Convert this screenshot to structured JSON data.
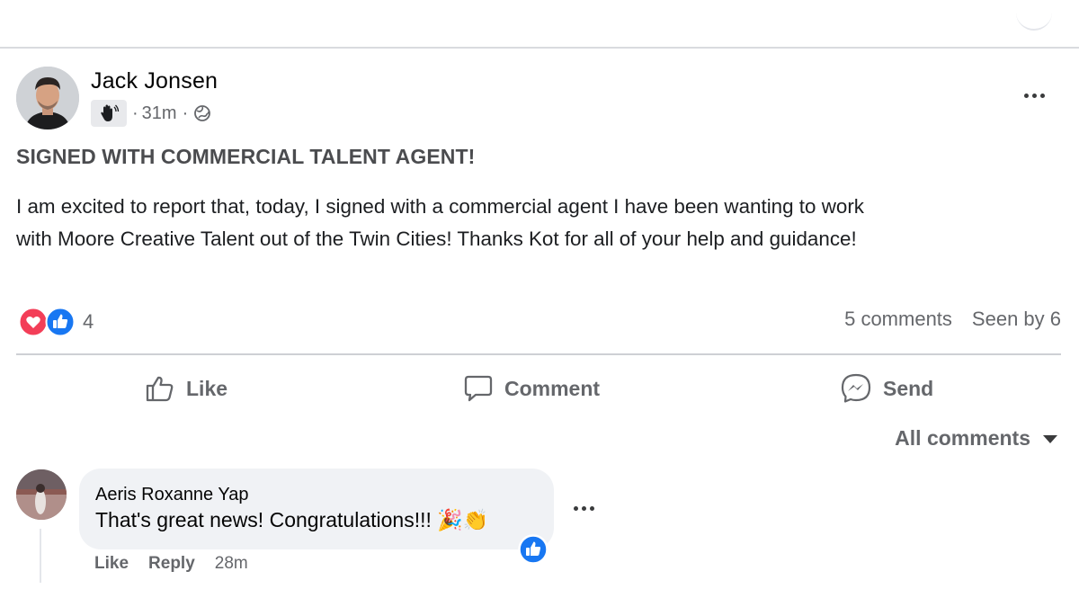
{
  "post": {
    "author": "Jack Jonsen",
    "time": "31m",
    "sep": "·",
    "headline": "SIGNED WITH COMMERCIAL TALENT AGENT!",
    "body_line1": "I am excited to report that, today, I signed with a commercial agent I have been wanting to work",
    "body_line2": "with Moore Creative Talent out of the Twin Cities! Thanks Kot for all of your help and guidance!",
    "reaction_count": "4",
    "comments_count": "5 comments",
    "seen_by": "Seen by 6",
    "icons": {
      "badge": "wave-hand-icon",
      "privacy": "globe-icon",
      "reactions": [
        "love-icon",
        "like-icon"
      ]
    }
  },
  "actions": {
    "like": "Like",
    "comment": "Comment",
    "send": "Send"
  },
  "all_comments": "All comments",
  "comment": {
    "author": "Aeris Roxanne Yap",
    "text": "That's great news! Congratulations!!! 🎉👏",
    "like": "Like",
    "reply": "Reply",
    "time": "28m"
  },
  "colors": {
    "like_blue": "#1877f2",
    "love_red": "#f33e58",
    "meta_gray": "#65676b"
  }
}
